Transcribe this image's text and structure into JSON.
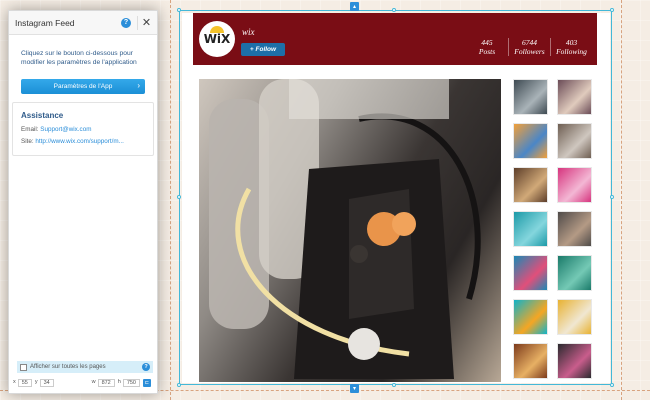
{
  "panel": {
    "title": "Instagram Feed",
    "help_glyph": "?",
    "close_glyph": "✕",
    "intro": "Cliquez sur le bouton ci-dessous pour modifier les paramètres de l'application",
    "app_button": "Paramètres de l'App",
    "app_button_arrow": "›",
    "assistance": {
      "title": "Assistance",
      "email_label": "Email:",
      "email": "Support@wix.com",
      "site_label": "Site:",
      "site": "http://www.wix.com/support/m..."
    },
    "show_all_label": "Afficher sur toutes les pages",
    "coords": {
      "x_label": "x",
      "x": "55",
      "y_label": "y",
      "y": "34",
      "w_label": "w",
      "w": "872",
      "h_label": "h",
      "h": "750"
    }
  },
  "instagram": {
    "username": "wix",
    "avatar_text": "WiX",
    "follow_button": "+ Follow",
    "stats": [
      {
        "value": "445",
        "label": "Posts"
      },
      {
        "value": "6744",
        "label": "Followers"
      },
      {
        "value": "403",
        "label": "Following"
      }
    ],
    "header_color": "#7a0d15",
    "thumbnails": [
      {
        "c1": "#3e4a52",
        "c2": "#a9b3b8"
      },
      {
        "c1": "#6b4c57",
        "c2": "#e0cbbd"
      },
      {
        "c1": "#f2a03a",
        "c2": "#4a86c7"
      },
      {
        "c1": "#6e5e52",
        "c2": "#cfc7bf"
      },
      {
        "c1": "#5d3e2a",
        "c2": "#d1a978"
      },
      {
        "c1": "#d6347e",
        "c2": "#f3b7d4"
      },
      {
        "c1": "#1d9aa8",
        "c2": "#84d6dd"
      },
      {
        "c1": "#4f4b49",
        "c2": "#b49a85"
      },
      {
        "c1": "#1b88b5",
        "c2": "#e14f7a"
      },
      {
        "c1": "#1a7a6a",
        "c2": "#74c9b5"
      },
      {
        "c1": "#10b3c9",
        "c2": "#f5a623"
      },
      {
        "c1": "#e8b232",
        "c2": "#f0e7d2"
      },
      {
        "c1": "#7d3b1c",
        "c2": "#e7b064"
      },
      {
        "c1": "#2a2a2e",
        "c2": "#c95d8c"
      }
    ]
  }
}
